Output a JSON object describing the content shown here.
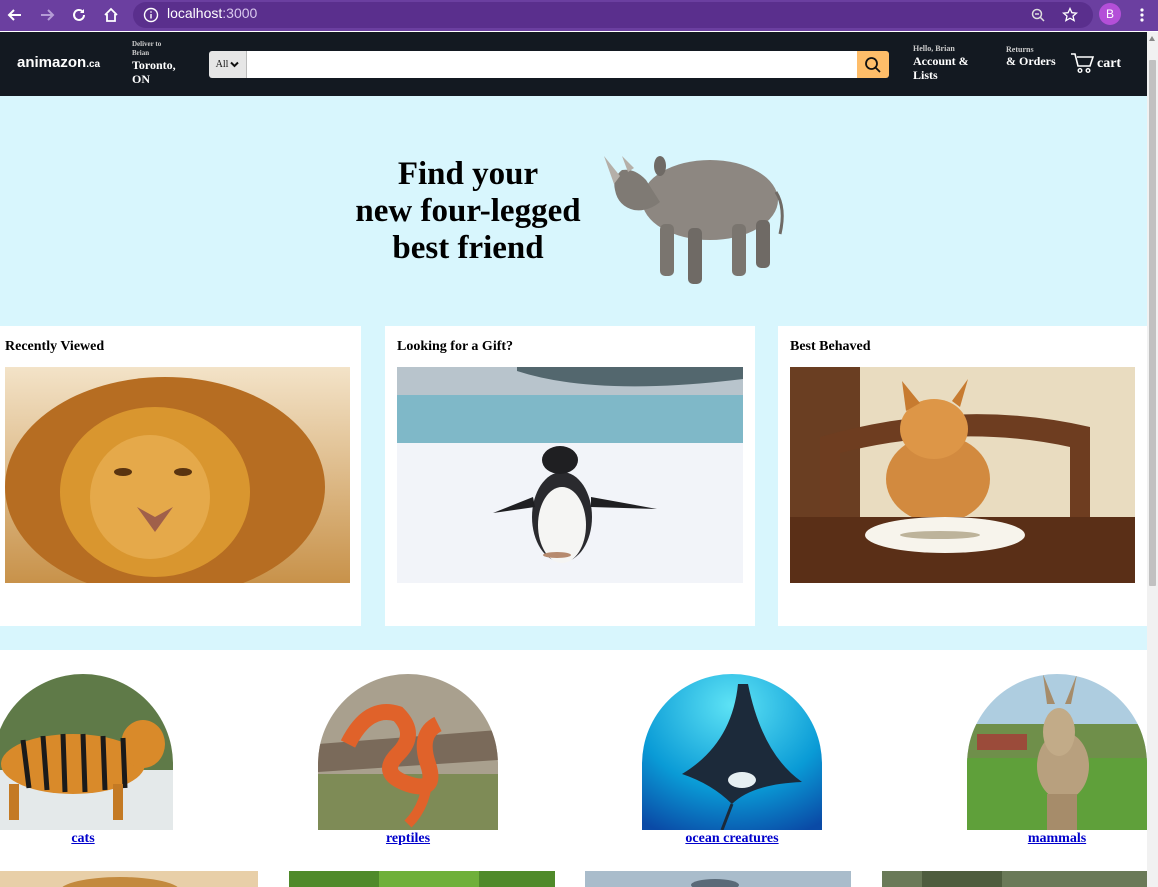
{
  "browser": {
    "url_host": "localhost",
    "url_port": ":3000",
    "profile_initial": "B"
  },
  "header": {
    "logo_main": "animazon",
    "logo_suffix": ".ca",
    "deliver_label": "Deliver to Brian",
    "deliver_location": "Toronto, ON",
    "search_category": "All",
    "search_value": "",
    "account_greeting": "Hello, Brian",
    "account_label": "Account & Lists",
    "returns_label": "Returns",
    "orders_label": "& Orders",
    "cart_label": "cart"
  },
  "hero": {
    "line1": "Find your",
    "line2": "new four-legged",
    "line3": "best friend"
  },
  "cards": [
    {
      "title": "Recently Viewed"
    },
    {
      "title": "Looking for a Gift?"
    },
    {
      "title": "Best Behaved"
    }
  ],
  "categories": [
    {
      "label": "cats"
    },
    {
      "label": "reptiles"
    },
    {
      "label": "ocean creatures"
    },
    {
      "label": "mammals"
    }
  ],
  "colors": {
    "browser_chrome": "#6b3fa0",
    "header_bg": "#131921",
    "search_button": "#febd69",
    "hero_bg": "#d8f6fd",
    "link": "#0000cc"
  }
}
